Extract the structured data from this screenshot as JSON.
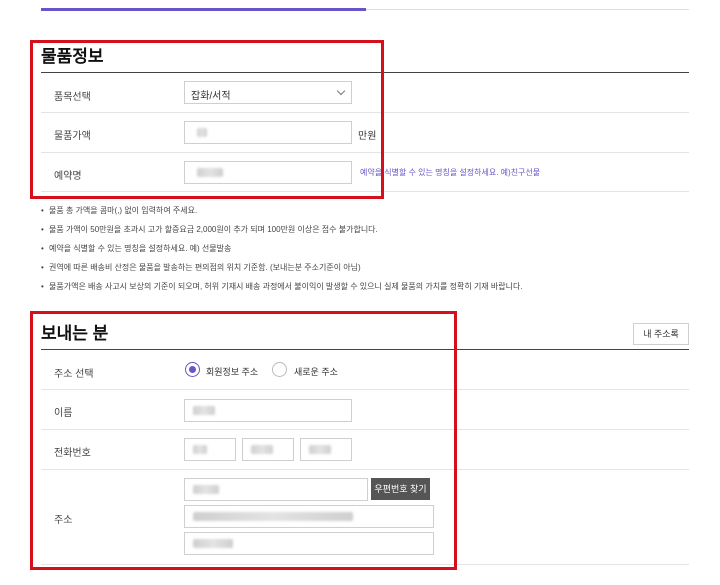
{
  "colors": {
    "accent": "#6a54c9",
    "highlight_box": "#d3101c",
    "zip_button_bg": "#555555"
  },
  "item_section": {
    "title": "물품정보",
    "category": {
      "label": "품목선택",
      "selected": "잡화/서적",
      "icon": "chevron-down-icon"
    },
    "price": {
      "label": "물품가액",
      "unit": "만원"
    },
    "reservation_name": {
      "label": "예약명",
      "hint": "예약을 식별할 수 있는 명칭을 설정하세요. 예)친구선물"
    }
  },
  "notes": [
    "물품 총 가액을 콤마(,) 없이 입력하여 주세요.",
    "물품 가액이 50만원을 초과시 고가 할증요금 2,000원이 추가 되며 100만원 이상은 접수 불가합니다.",
    "예약을 식별할 수 있는 명칭을 설정하세요. 예) 선물발송",
    "권역에 따른 배송비 산정은 물품을 발송하는 편의점의 위치 기준함. (보내는분 주소기준이 아님)",
    "물품가액은 배송 사고시 보상의 기준이 되오며, 허위 기재시 배송 과정에서 불이익이 발생할 수 있으니 실제 물품의 가치를 정확히 기재 바랍니다."
  ],
  "sender_section": {
    "title": "보내는 분",
    "address_book_button": "내 주소록",
    "address_choice": {
      "label": "주소 선택",
      "options": [
        {
          "label": "회원정보 주소",
          "selected": true
        },
        {
          "label": "새로운 주소",
          "selected": false
        }
      ]
    },
    "name": {
      "label": "이름"
    },
    "phone": {
      "label": "전화번호"
    },
    "address": {
      "label": "주소",
      "zip_button": "우편번호 찾기"
    }
  }
}
